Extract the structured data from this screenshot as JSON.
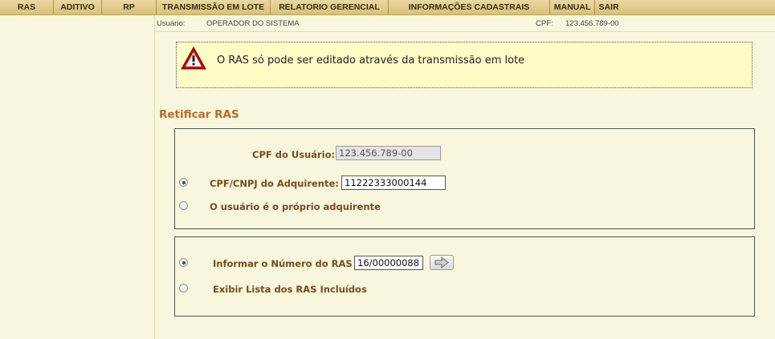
{
  "menu": {
    "items": [
      "RAS",
      "ADITIVO",
      "RP",
      "TRANSMISSÃO EM LOTE",
      "RELATORIO GERENCIAL",
      "INFORMAÇÕES CADASTRAIS",
      "MANUAL",
      "SAIR"
    ]
  },
  "user_bar": {
    "user_label": "Usuário:",
    "user_value": "OPERADOR DO SISTEMA",
    "cpf_label": "CPF:",
    "cpf_value": "123.456.789-00"
  },
  "warning": {
    "icon": "warning-triangle-icon",
    "message": "O RAS só pode ser editado através da transmissão em lote",
    "accent_color": "#cc0000"
  },
  "form": {
    "title": "Retificar RAS",
    "cpf_usuario_label": "CPF do Usuário:",
    "cpf_usuario_value": "123.456.789-00",
    "adquirente_label": "CPF/CNPJ do Adquirente:",
    "adquirente_value": "11222333000144",
    "adquirente_selected": true,
    "proprio_label": "O usuário é o próprio adquirente",
    "proprio_selected": false,
    "numero_label": "Informar o Número do RAS",
    "numero_value": "16/00000088",
    "numero_selected": true,
    "lista_label": "Exibir Lista dos RAS Incluídos",
    "lista_selected": false,
    "go_icon": "arrow-right-icon"
  }
}
